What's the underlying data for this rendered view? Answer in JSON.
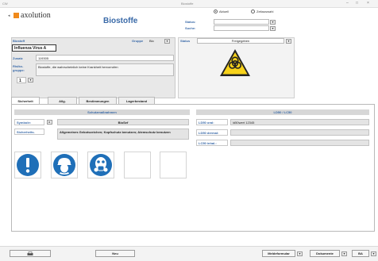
{
  "window": {
    "app_label": "CW",
    "title": "Biostoffe",
    "controls": [
      "–",
      "□",
      "×"
    ]
  },
  "logo": {
    "text": "axolution"
  },
  "page_title": "Biostoffe",
  "filter": {
    "radio_aktuell": "Aktuell",
    "radio_zeitauswahl": "Zeitauswahl",
    "status_label": "Status:",
    "suche_label": "Suche:"
  },
  "header": {
    "biostoff_label": "Biostoff",
    "biostoff_value": "Influenza Virus A",
    "gruppe_label": "Gruppe",
    "gruppe_value": "Bio",
    "zusatz_label": "Zusatz",
    "zusatz_value": "119305",
    "risikogruppe_label": "Risiko-gruppe:",
    "risikogruppe_value": "1",
    "description": "Biostoffe, die wahrscheinlich keine Krankheit hervorrufen"
  },
  "status": {
    "label": "Status",
    "value": "Freigegeben"
  },
  "tabs": [
    "Sicherheit",
    "Allg.",
    "Bestimmungen",
    "Lagerbestand"
  ],
  "sicherheit": {
    "schutz_header": "Schutzmaßnahmen",
    "symbole_label": "Symbole:",
    "symbole_value": "BioSef",
    "sicherheits_label": "Sicherheits.",
    "sicherheits_value": "Allgemeines Gebotszeichen; Kopfschutz benutzen; Atemschutz benutzen",
    "ldso_header": "LD50 / LC50",
    "ld50_oral_label": "LD50 oral:",
    "ld50_oral_value": "ld50wert 12345",
    "ld50_dermal_label": "LD50 dermal:",
    "ld50_dermal_value": "",
    "lc50_inhal_label": "LC50 inhal.:",
    "lc50_inhal_value": ""
  },
  "pictograms": [
    "exclamation-icon",
    "head-protection-icon",
    "respirator-icon",
    "empty",
    "empty"
  ],
  "bottom": {
    "print_button": "",
    "neu_button": "Neu",
    "meldeformular_button": "Meldeformular",
    "dokumente_button": "Dokumente",
    "ba_button": "BA"
  },
  "colors": {
    "accent": "#3a6aa8",
    "logo_orange": "#f08a1c",
    "mandatory_blue": "#1f6fb8",
    "hazard_yellow": "#f7d21a"
  }
}
